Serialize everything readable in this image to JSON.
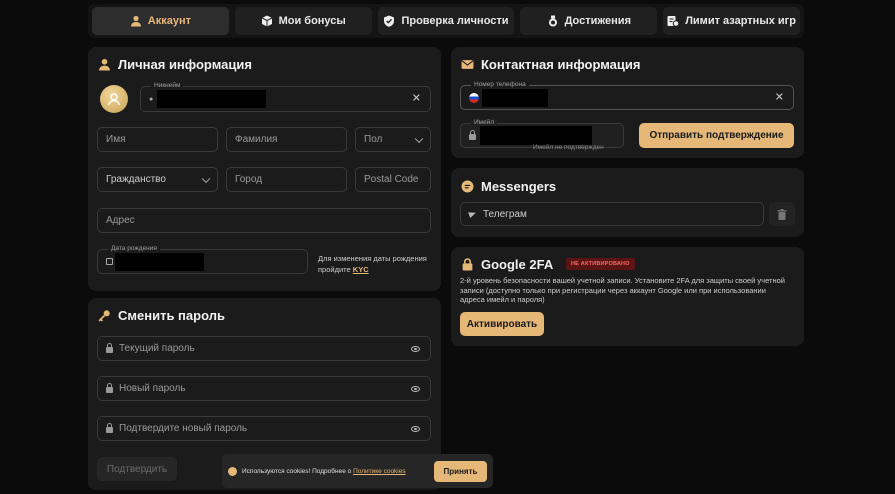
{
  "tabs": [
    {
      "label": "Аккаунт",
      "icon": "user-icon",
      "active": true
    },
    {
      "label": "Мои бонусы",
      "icon": "cube-icon",
      "active": false
    },
    {
      "label": "Проверка личности",
      "icon": "shield-icon",
      "active": false
    },
    {
      "label": "Достижения",
      "icon": "medal-icon",
      "active": false
    },
    {
      "label": "Лимит азартных игр",
      "icon": "limit-icon",
      "active": false
    }
  ],
  "personal": {
    "title": "Личная информация",
    "nickname_label": "Никнейм",
    "first_name_placeholder": "Имя",
    "last_name_placeholder": "Фамилия",
    "gender_placeholder": "Пол",
    "citizenship_placeholder": "Гражданство",
    "city_placeholder": "Город",
    "postal_placeholder": "Postal Code",
    "address_placeholder": "Адрес",
    "birthdate_label": "Дата рождения",
    "kyc_note": "Для изменения даты рождения пройдите",
    "kyc_link": "KYC"
  },
  "password": {
    "title": "Сменить пароль",
    "current_placeholder": "Текущий пароль",
    "new_placeholder": "Новый пароль",
    "confirm_placeholder": "Подтвердите новый пароль",
    "submit_label": "Подтвердить"
  },
  "contact": {
    "title": "Контактная информация",
    "phone_label": "Номер телефона",
    "email_label": "Имейл",
    "email_hint": "Имейл не подтвержден",
    "send_confirm_label": "Отправить подтверждение"
  },
  "messengers": {
    "title": "Messengers",
    "telegram_label": "Телеграм"
  },
  "twofa": {
    "title": "Google 2FA",
    "badge": "НЕ АКТИВИРОВАНО",
    "description": "2-й уровень безопасности вашей учетной записи. Установите 2FA для защиты своей учетной записи (доступно только при регистрации через аккаунт Google или при использовании адреса имейл и пароля)",
    "activate_label": "Активировать"
  },
  "cookie": {
    "text": "Используются cookies! Подробнее о",
    "link": "Политике cookies",
    "accept_label": "Принять"
  },
  "colors": {
    "accent": "#e6b878",
    "background": "#0b0b0b",
    "card": "#1b1b1b",
    "danger_badge": "#5a1414"
  }
}
